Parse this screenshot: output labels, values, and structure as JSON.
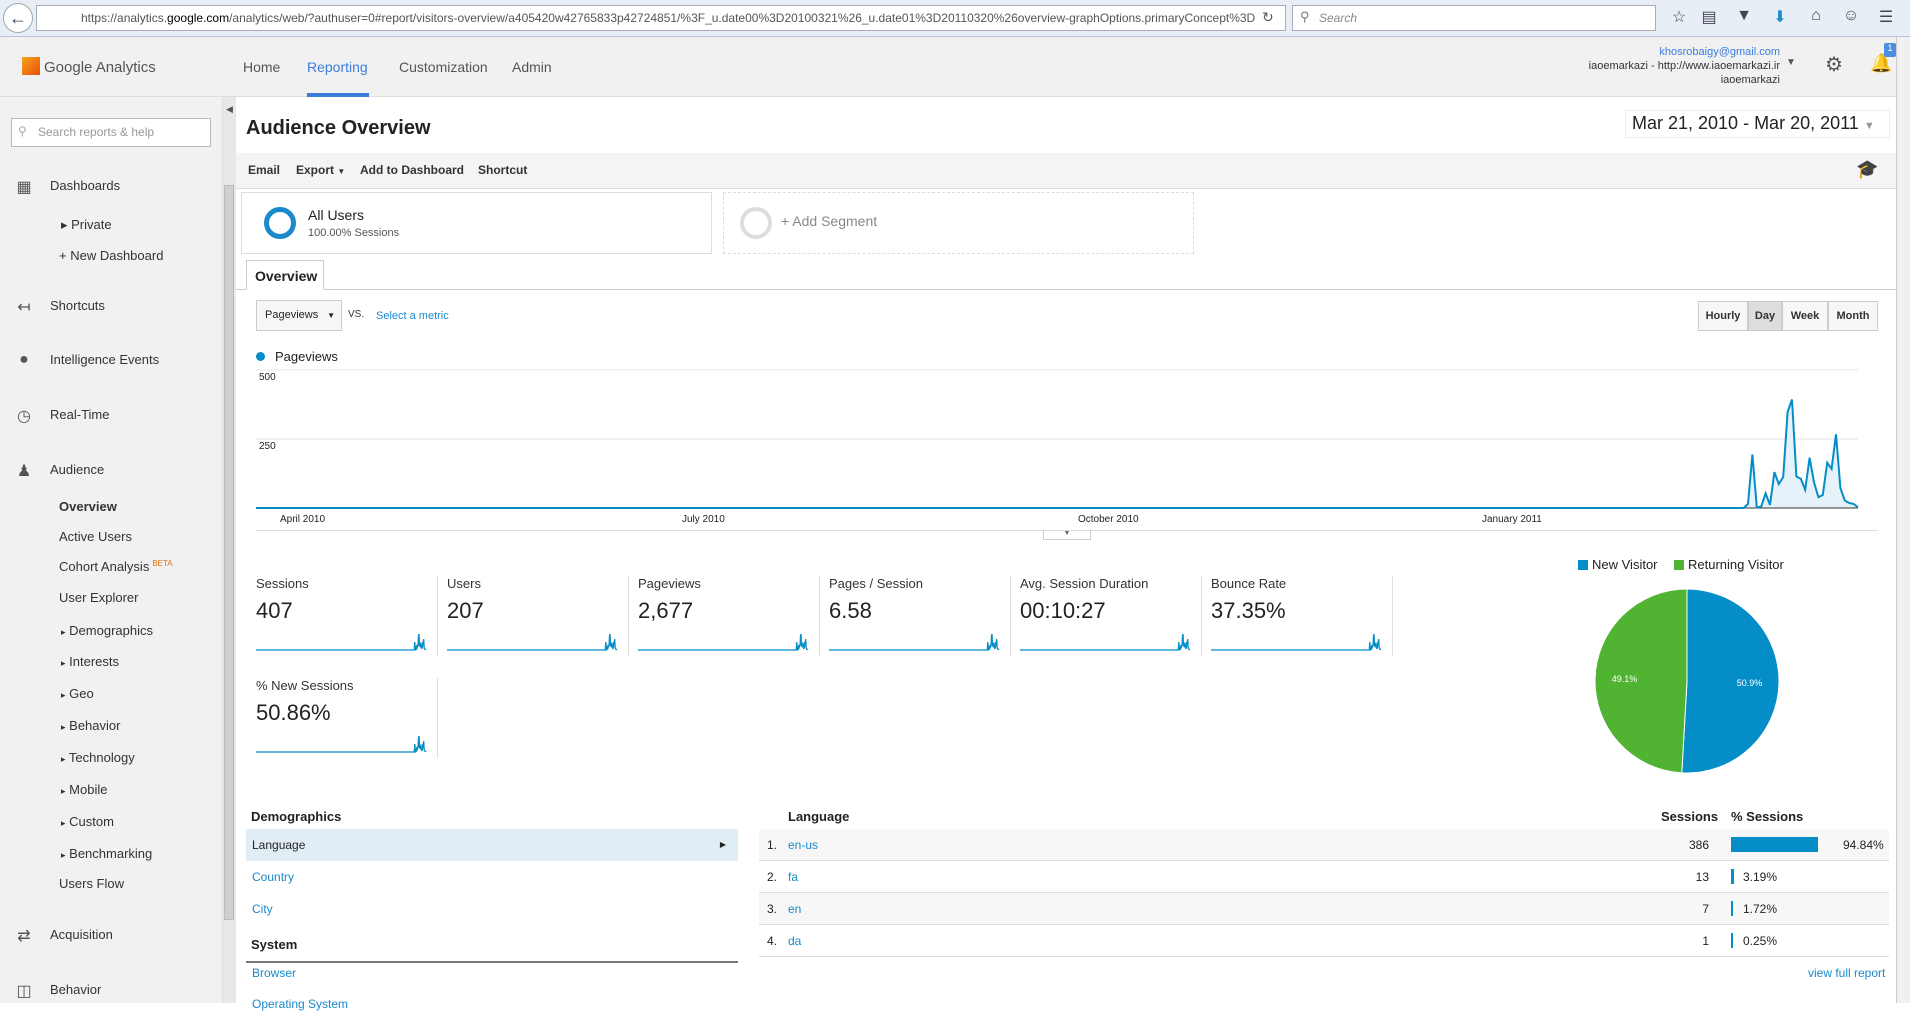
{
  "browser": {
    "url_prefix": "https://analytics.",
    "url_domain": "google.com",
    "url_rest": "/analytics/web/?authuser=0#report/visitors-overview/a405420w42765833p42724851/%3F_u.date00%3D20100321%26_u.date01%3D20110320%26overview-graphOptions.primaryConcept%3D",
    "search_placeholder": "Search"
  },
  "header": {
    "app_name": "Google Analytics",
    "nav": [
      "Home",
      "Reporting",
      "Customization",
      "Admin"
    ],
    "account_email": "khosrobaigy@gmail.com",
    "account_property": "iaoemarkazi - http://www.iaoemarkazi.ir",
    "account_view": "iaoemarkazi",
    "notification_count": "1"
  },
  "sidebar": {
    "search_placeholder": "Search reports & help",
    "dashboards": "Dashboards",
    "private": "Private",
    "new_dashboard": "+ New Dashboard",
    "shortcuts": "Shortcuts",
    "intelligence": "Intelligence Events",
    "realtime": "Real-Time",
    "audience": "Audience",
    "audience_items": [
      "Overview",
      "Active Users",
      "Cohort Analysis",
      "User Explorer",
      "Demographics",
      "Interests",
      "Geo",
      "Behavior",
      "Technology",
      "Mobile",
      "Custom",
      "Benchmarking",
      "Users Flow"
    ],
    "beta": "BETA",
    "acquisition": "Acquisition",
    "behavior": "Behavior"
  },
  "page": {
    "title": "Audience Overview",
    "date_range": "Mar 21, 2010 - Mar 20, 2011",
    "toolbar": [
      "Email",
      "Export",
      "Add to Dashboard",
      "Shortcut"
    ],
    "segment": {
      "name": "All Users",
      "detail": "100.00% Sessions",
      "add": "+ Add Segment"
    },
    "tab": "Overview",
    "metric": "Pageviews",
    "vs": "VS.",
    "select_metric": "Select a metric",
    "granularity": [
      "Hourly",
      "Day",
      "Week",
      "Month"
    ],
    "granularity_selected": "Day"
  },
  "chart_data": [
    {
      "type": "area",
      "title": "",
      "legend": [
        "Pageviews"
      ],
      "color": "#058dc7",
      "ylim": [
        0,
        500
      ],
      "yticks": [
        "500",
        "250"
      ],
      "xticks": [
        "April 2010",
        "July 2010",
        "October 2010",
        "January 2011"
      ],
      "x_start": "2010-03-21",
      "x_end": "2011-03-20",
      "leading_zero_days": 338,
      "values_tail": [
        0,
        15,
        194,
        2,
        5,
        53,
        11,
        130,
        87,
        112,
        348,
        393,
        114,
        106,
        66,
        182,
        93,
        39,
        47,
        164,
        142,
        267,
        72,
        27,
        18,
        15,
        2
      ]
    },
    {
      "type": "pie",
      "legend": [
        "New Visitor",
        "Returning Visitor"
      ],
      "values": [
        50.9,
        49.1
      ],
      "labels": [
        "50.9%",
        "49.1%"
      ],
      "colors": [
        "#058dc7",
        "#50b432"
      ]
    }
  ],
  "metrics": [
    {
      "label": "Sessions",
      "value": "407"
    },
    {
      "label": "Users",
      "value": "207"
    },
    {
      "label": "Pageviews",
      "value": "2,677"
    },
    {
      "label": "Pages / Session",
      "value": "6.58"
    },
    {
      "label": "Avg. Session Duration",
      "value": "00:10:27"
    },
    {
      "label": "Bounce Rate",
      "value": "37.35%"
    },
    {
      "label": "% New Sessions",
      "value": "50.86%"
    }
  ],
  "demographics": {
    "header": "Demographics",
    "items": [
      "Language",
      "Country",
      "City"
    ],
    "system_header": "System",
    "system_items": [
      "Browser",
      "Operating System"
    ]
  },
  "language_table": {
    "header": "Language",
    "col_sessions": "Sessions",
    "col_pct": "% Sessions",
    "rows": [
      {
        "rank": "1.",
        "lang": "en-us",
        "sessions": "386",
        "pct": "94.84%",
        "frac": 0.9484
      },
      {
        "rank": "2.",
        "lang": "fa",
        "sessions": "13",
        "pct": "3.19%",
        "frac": 0.0319
      },
      {
        "rank": "3.",
        "lang": "en",
        "sessions": "7",
        "pct": "1.72%",
        "frac": 0.0172
      },
      {
        "rank": "4.",
        "lang": "da",
        "sessions": "1",
        "pct": "0.25%",
        "frac": 0.0025
      }
    ],
    "view_full": "view full report"
  }
}
